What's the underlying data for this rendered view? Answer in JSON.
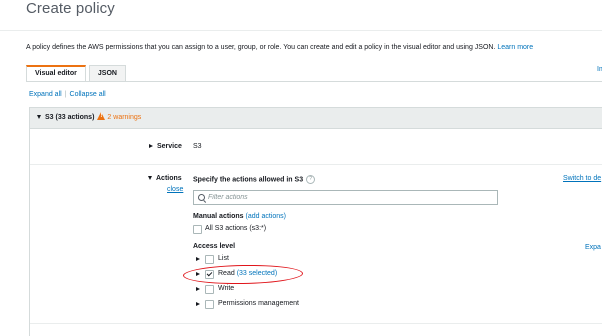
{
  "page": {
    "title": "Create policy",
    "description": "A policy defines the AWS permissions that you can assign to a user, group, or role. You can create and edit a policy in the visual editor and using JSON.",
    "learn_more": "Learn more",
    "import_link": "Im"
  },
  "tabs": [
    {
      "label": "Visual editor",
      "active": true
    },
    {
      "label": "JSON",
      "active": false
    }
  ],
  "expand_all": "Expand all",
  "separator": "|",
  "collapse_all": "Collapse all",
  "service_panel": {
    "header": "S3 (33 actions)",
    "warnings": "2 warnings",
    "warning_color": "#ec7211",
    "service_label": "Service",
    "service_value": "S3",
    "actions_label": "Actions",
    "close": "close",
    "actions_title": "Specify the actions allowed in S3",
    "help_glyph": "?",
    "switch_link": "Switch to de",
    "filter_placeholder": "Filter actions",
    "manual_actions_label": "Manual actions",
    "add_actions": "(add actions)",
    "all_s3_actions": "All S3 actions (s3:*)",
    "access_level_label": "Access level",
    "expand_link": "Expa",
    "access_levels": [
      {
        "label": "List",
        "checked": false,
        "count": ""
      },
      {
        "label": "Read",
        "checked": true,
        "count": "(33 selected)"
      },
      {
        "label": "Write",
        "checked": false,
        "count": ""
      },
      {
        "label": "Permissions management",
        "checked": false,
        "count": ""
      }
    ]
  },
  "colors": {
    "link": "#0073bb",
    "accent": "#ec7211",
    "annotation": "#e0151b"
  }
}
